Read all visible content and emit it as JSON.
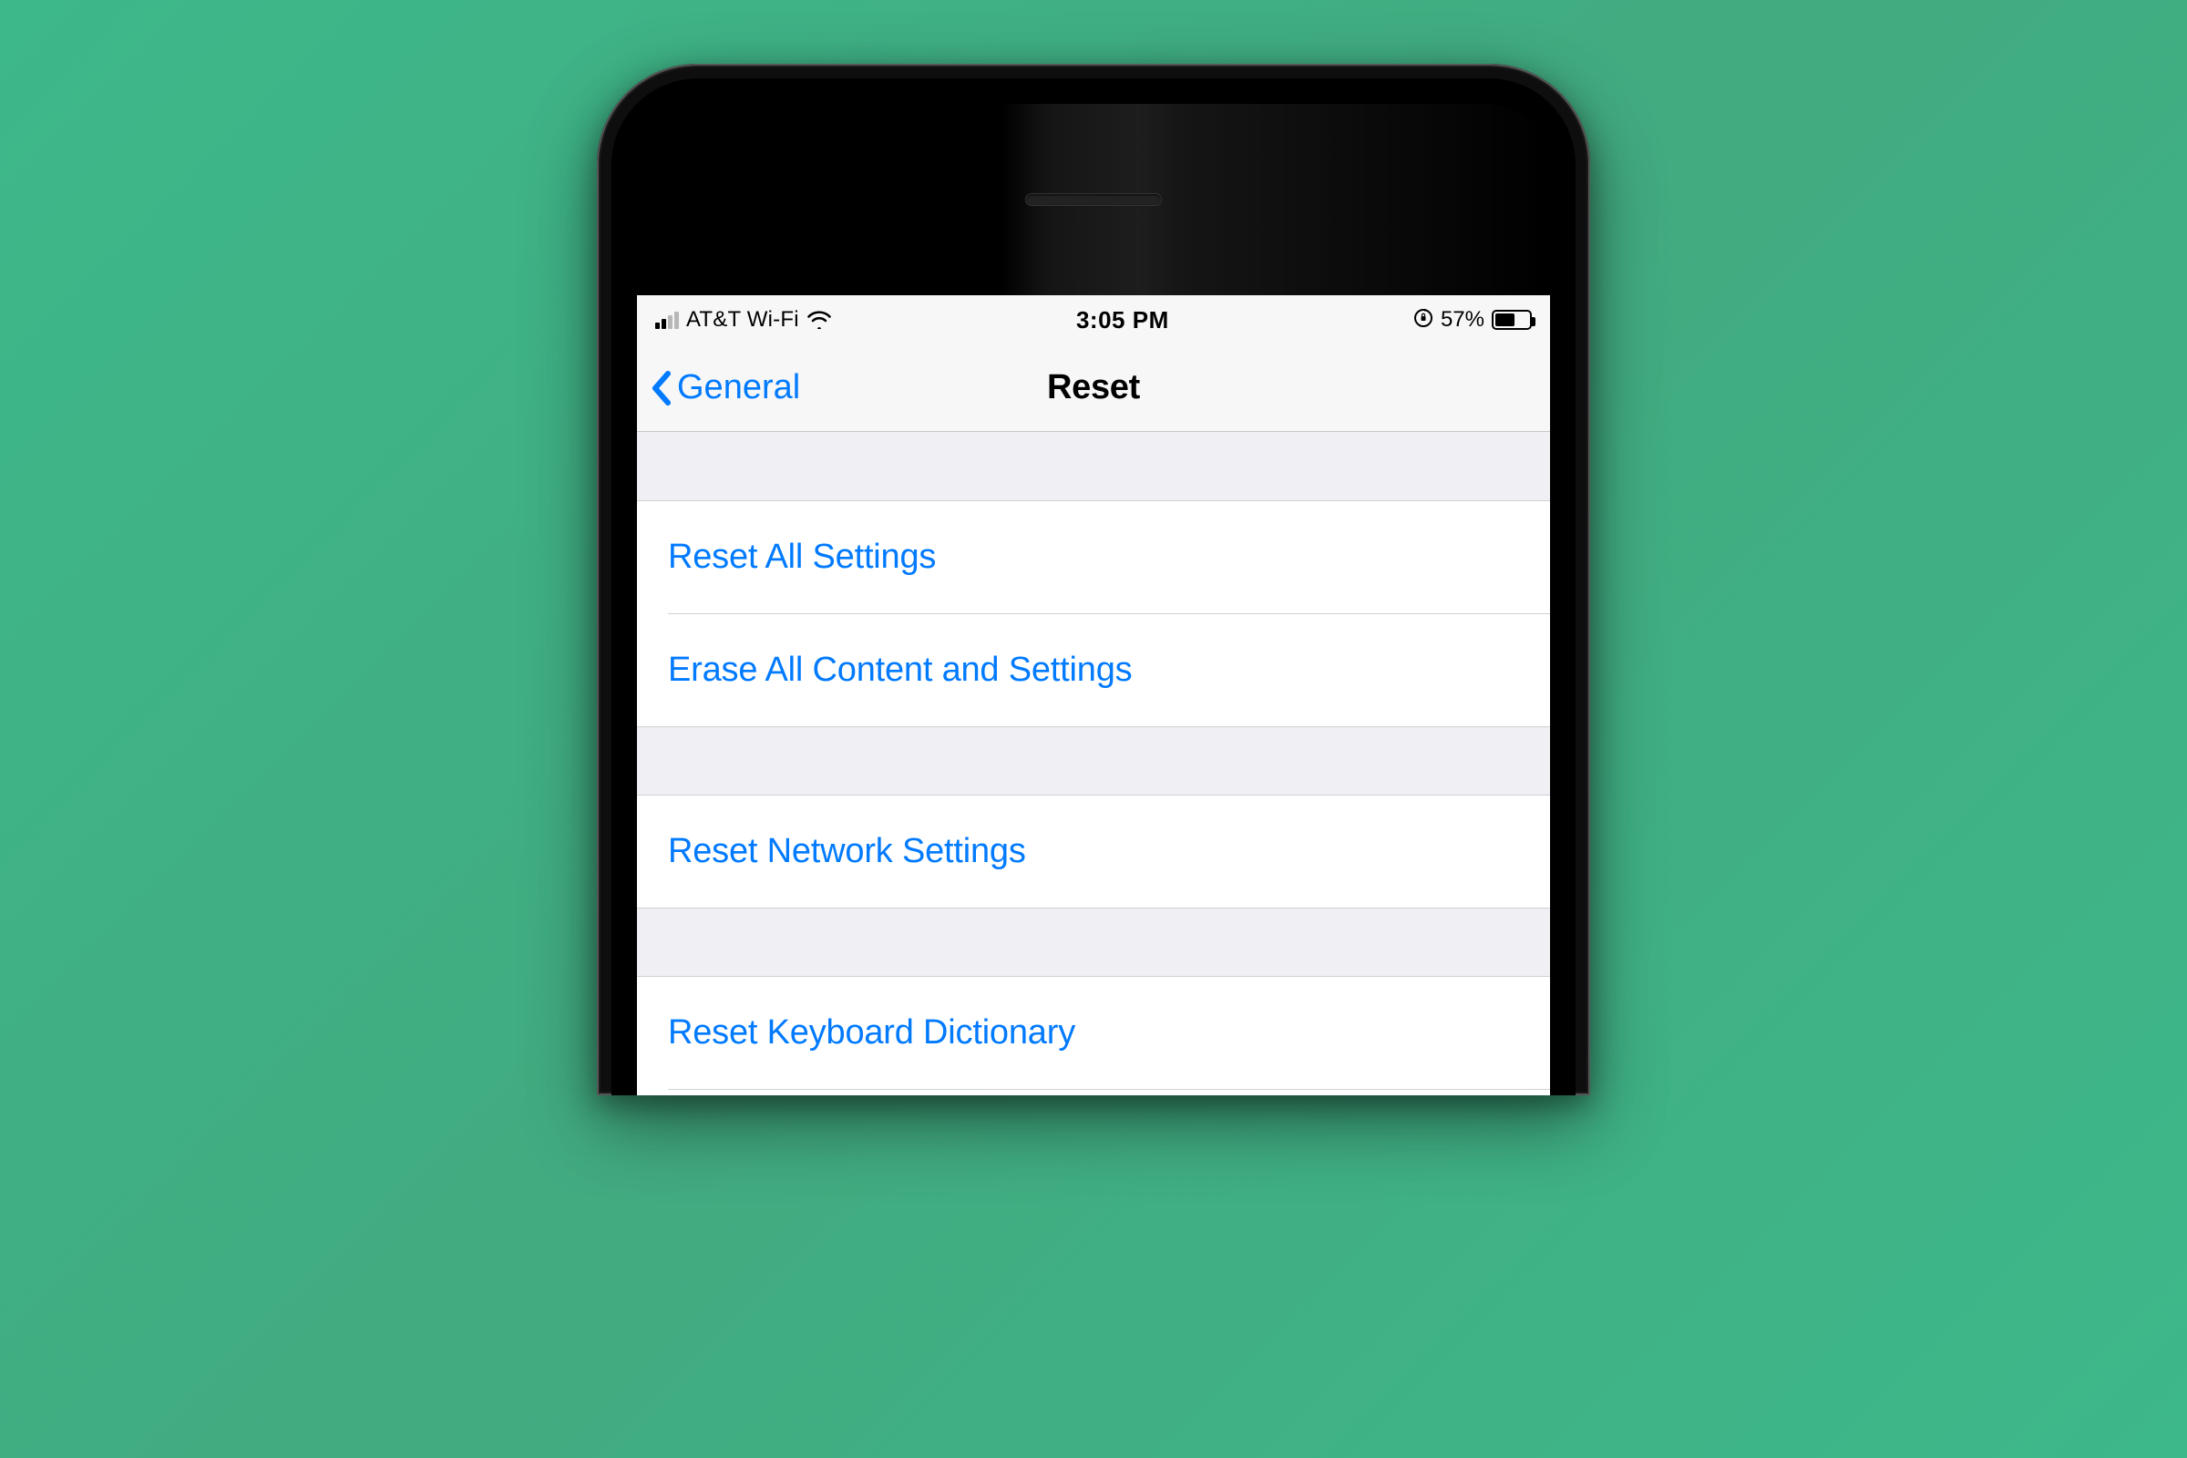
{
  "status_bar": {
    "carrier": "AT&T Wi-Fi",
    "time": "3:05 PM",
    "battery_percent": "57%"
  },
  "nav": {
    "back_label": "General",
    "title": "Reset"
  },
  "sections": [
    {
      "items": [
        {
          "label": "Reset All Settings"
        },
        {
          "label": "Erase All Content and Settings"
        }
      ]
    },
    {
      "items": [
        {
          "label": "Reset Network Settings"
        }
      ]
    },
    {
      "items": [
        {
          "label": "Reset Keyboard Dictionary"
        }
      ]
    }
  ],
  "colors": {
    "ios_blue": "#007aff",
    "grouped_bg": "#efeff4"
  }
}
